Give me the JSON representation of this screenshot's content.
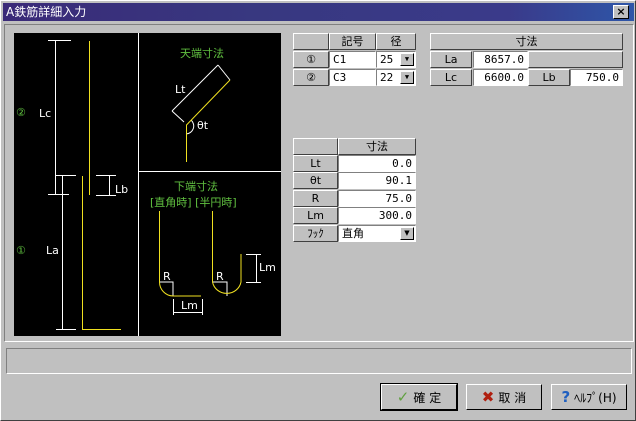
{
  "window": {
    "title": "A鉄筋詳細入力",
    "close_label": "×"
  },
  "diagram": {
    "left": {
      "mark2": "②",
      "lc": "Lc",
      "lb": "Lb",
      "mark1": "①",
      "la": "La"
    },
    "top": {
      "title": "天端寸法",
      "lt": "Lt",
      "theta": "θt"
    },
    "bottom": {
      "title": "下端寸法",
      "subtitle": "[直角時] [半円時]",
      "r1": "R",
      "r2": "R",
      "lm1": "Lm",
      "lm2": "Lm"
    },
    "colors": {
      "bar": "#f0e020",
      "label": "#60c040",
      "dim": "#ffffff"
    }
  },
  "bars": {
    "headers": [
      "",
      "記号",
      "径"
    ],
    "rows": [
      {
        "label": "①",
        "symbol": "C1",
        "dia": "25"
      },
      {
        "label": "②",
        "symbol": "C3",
        "dia": "22"
      }
    ]
  },
  "dims": {
    "header": "寸法",
    "la_label": "La",
    "la": "8657.0",
    "lc_label": "Lc",
    "lc": "6600.0",
    "lb_label": "Lb",
    "lb": "750.0"
  },
  "ends": {
    "header": "寸法",
    "rows": [
      {
        "label": "Lt",
        "value": "0.0"
      },
      {
        "label": "θt",
        "value": "90.1"
      },
      {
        "label": "R",
        "value": "75.0"
      },
      {
        "label": "Lm",
        "value": "300.0"
      }
    ],
    "hook_label": "ﾌｯｸ",
    "hook": "直角"
  },
  "buttons": {
    "ok": "確 定",
    "cancel": "取 消",
    "help": "ﾍﾙﾌﾟ(H)"
  }
}
